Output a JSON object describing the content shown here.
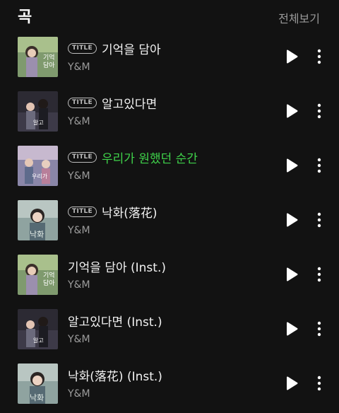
{
  "header": {
    "title": "곡",
    "view_all": "전체보기"
  },
  "badge_text": "TITLE",
  "colors": {
    "background": "#121212",
    "now_playing": "#3fd24a",
    "secondary_text": "#9c9c9c"
  },
  "tracks": [
    {
      "title": "기억을 담아",
      "artist": "Y&M",
      "badge": true,
      "playing": false,
      "art": "album-art-a"
    },
    {
      "title": "알고있다면",
      "artist": "Y&M",
      "badge": true,
      "playing": false,
      "art": "album-art-b"
    },
    {
      "title": "우리가 원했던 순간",
      "artist": "Y&M",
      "badge": true,
      "playing": true,
      "art": "album-art-c"
    },
    {
      "title": "낙화(落花)",
      "artist": "Y&M",
      "badge": true,
      "playing": false,
      "art": "album-art-d"
    },
    {
      "title": "기억을 담아 (Inst.)",
      "artist": "Y&M",
      "badge": false,
      "playing": false,
      "art": "album-art-a"
    },
    {
      "title": "알고있다면 (Inst.)",
      "artist": "Y&M",
      "badge": false,
      "playing": false,
      "art": "album-art-b"
    },
    {
      "title": "낙화(落花) (Inst.)",
      "artist": "Y&M",
      "badge": false,
      "playing": false,
      "art": "album-art-d"
    }
  ],
  "icons": {
    "play": "play-icon",
    "more": "more-vertical-icon"
  }
}
